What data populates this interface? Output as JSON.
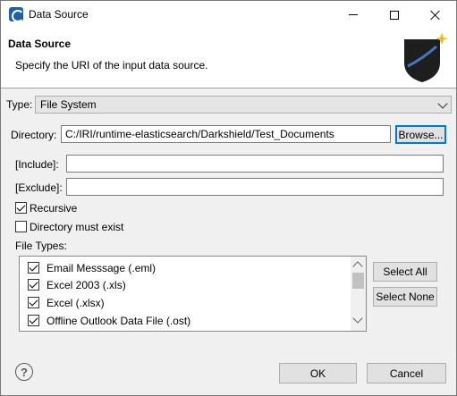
{
  "window": {
    "title": "Data Source",
    "icon": "eclipse-app-icon"
  },
  "banner": {
    "title": "Data Source",
    "description": "Specify the URI of the input data source.",
    "graphic": "darkshield-shield-graphic"
  },
  "form": {
    "type_label": "Type:",
    "type_value": "File System",
    "directory_label": "Directory:",
    "directory_value": "C:/IRI/runtime-elasticsearch/Darkshield/Test_Documents",
    "browse_label": "Browse...",
    "include_label": "[Include]:",
    "include_value": "",
    "exclude_label": "[Exclude]:",
    "exclude_value": "",
    "recursive_label": "Recursive",
    "recursive_checked": true,
    "dir_must_exist_label": "Directory must exist",
    "dir_must_exist_checked": false,
    "file_types_label": "File Types:"
  },
  "file_types": [
    {
      "label": "Email Messsage (.eml)",
      "checked": true
    },
    {
      "label": "Excel 2003 (.xls)",
      "checked": true
    },
    {
      "label": "Excel (.xlsx)",
      "checked": true
    },
    {
      "label": "Offline Outlook Data File (.ost)",
      "checked": true
    }
  ],
  "list_buttons": {
    "select_all": "Select All",
    "select_none": "Select None"
  },
  "footer": {
    "help_symbol": "?",
    "ok_label": "OK",
    "cancel_label": "Cancel"
  },
  "colors": {
    "accent": "#0078d7",
    "window_bg": "#f0f0f0"
  }
}
